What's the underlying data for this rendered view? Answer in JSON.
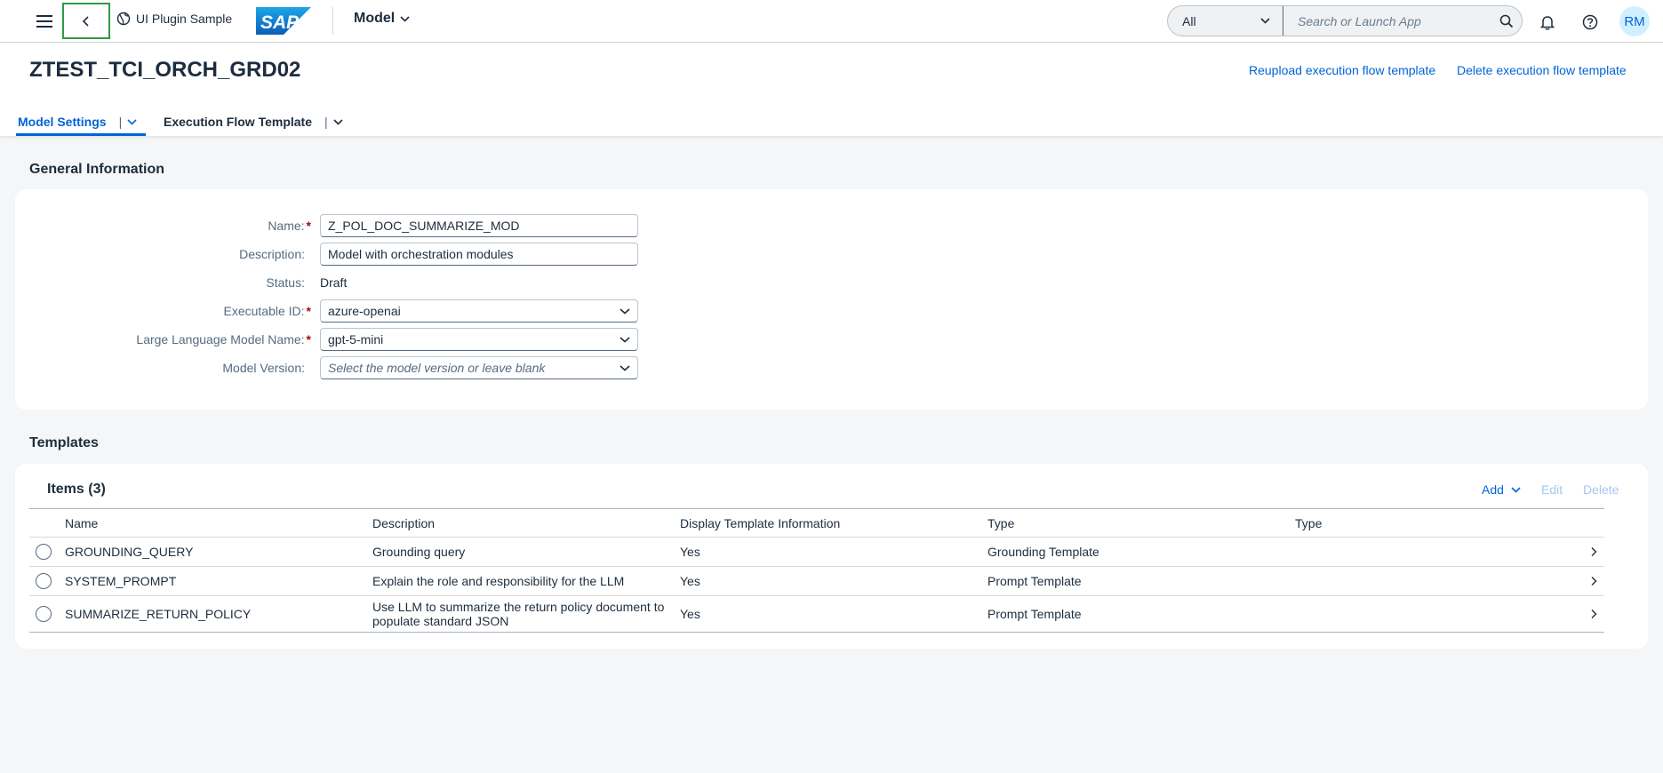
{
  "shell": {
    "app_title": "UI Plugin Sample",
    "model_menu": "Model",
    "search_scope": "All",
    "search_placeholder": "Search or Launch App",
    "avatar_initials": "RM"
  },
  "header": {
    "title": "ZTEST_TCI_ORCH_GRD02",
    "actions": {
      "reupload": "Reupload execution flow template",
      "delete": "Delete execution flow template"
    },
    "tabs": [
      {
        "label": "Model Settings",
        "active": true
      },
      {
        "label": "Execution Flow Template",
        "active": false
      }
    ]
  },
  "general": {
    "section_title": "General Information",
    "fields": {
      "name_label": "Name:",
      "name_value": "Z_POL_DOC_SUMMARIZE_MOD",
      "description_label": "Description:",
      "description_value": "Model with orchestration modules",
      "status_label": "Status:",
      "status_value": "Draft",
      "executable_label": "Executable ID:",
      "executable_value": "azure-openai",
      "llm_label": "Large Language Model Name:",
      "llm_value": "gpt-5-mini",
      "version_label": "Model Version:",
      "version_placeholder": "Select the model version or leave blank"
    }
  },
  "templates": {
    "section_title": "Templates",
    "items_title": "Items (3)",
    "toolbar": {
      "add": "Add",
      "edit": "Edit",
      "delete": "Delete"
    },
    "columns": [
      "Name",
      "Description",
      "Display Template Information",
      "Type",
      "Type"
    ],
    "rows": [
      {
        "name": "GROUNDING_QUERY",
        "description": "Grounding query",
        "display": "Yes",
        "type": "Grounding Template",
        "type2": ""
      },
      {
        "name": "SYSTEM_PROMPT",
        "description": "Explain the role and responsibility for the LLM",
        "display": "Yes",
        "type": "Prompt Template",
        "type2": ""
      },
      {
        "name": "SUMMARIZE_RETURN_POLICY",
        "description": "Use LLM to summarize the return policy document to populate standard JSON",
        "display": "Yes",
        "type": "Prompt Template",
        "type2": ""
      }
    ]
  },
  "colors": {
    "accent": "#0064d9",
    "required": "#aa0808",
    "back_focus": "#2e9b43"
  }
}
